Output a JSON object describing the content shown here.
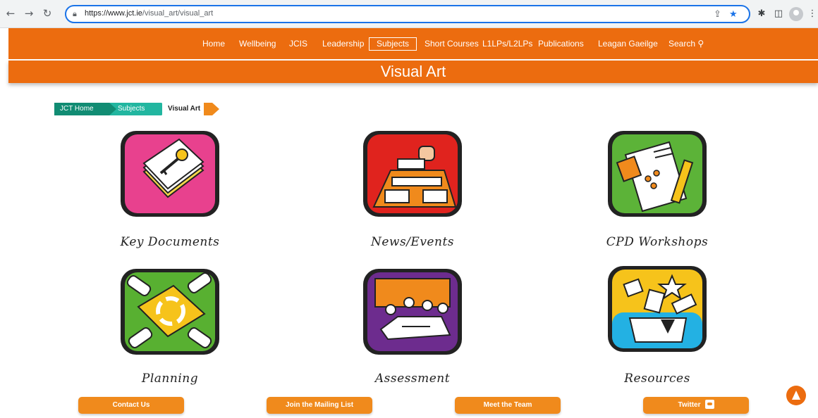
{
  "browser": {
    "url_host": "https://www.jct.ie",
    "url_path": "/visual_art/visual_art",
    "icons": [
      "back-icon",
      "forward-icon",
      "reload-icon",
      "lock-icon",
      "share-icon",
      "bookmark-star-icon",
      "extensions-puzzle-icon",
      "side-panel-icon",
      "profile-icon",
      "menu-kebab-icon"
    ]
  },
  "nav": {
    "items": [
      "Home",
      "Wellbeing",
      "JCIS",
      "Leadership",
      "Subjects",
      "Short Courses",
      "L1LPs/L2LPs",
      "Publications",
      "Leagan Gaeilge",
      "Search"
    ],
    "active": "Subjects"
  },
  "page": {
    "title": "Visual Art"
  },
  "breadcrumb": {
    "home": "JCT Home",
    "subjects": "Subjects",
    "current": "Visual Art"
  },
  "tiles": [
    {
      "label": "Key Documents",
      "color": "#e8418e"
    },
    {
      "label": "News/Events",
      "color": "#e0231e"
    },
    {
      "label": "CPD Workshops",
      "color": "#5cb338"
    },
    {
      "label": "Planning",
      "color": "#58b031"
    },
    {
      "label": "Assessment",
      "color": "#6d2c8e"
    },
    {
      "label": "Resources",
      "color": "#f6c31b"
    }
  ],
  "footer": {
    "contact": "Contact Us",
    "mailing": "Join the Mailing List",
    "team": "Meet the Team",
    "twitter": "Twitter"
  },
  "colors": {
    "brand_orange": "#ec6c0f",
    "crumb_teal_dark": "#118c73",
    "crumb_teal_light": "#22b6a0"
  }
}
